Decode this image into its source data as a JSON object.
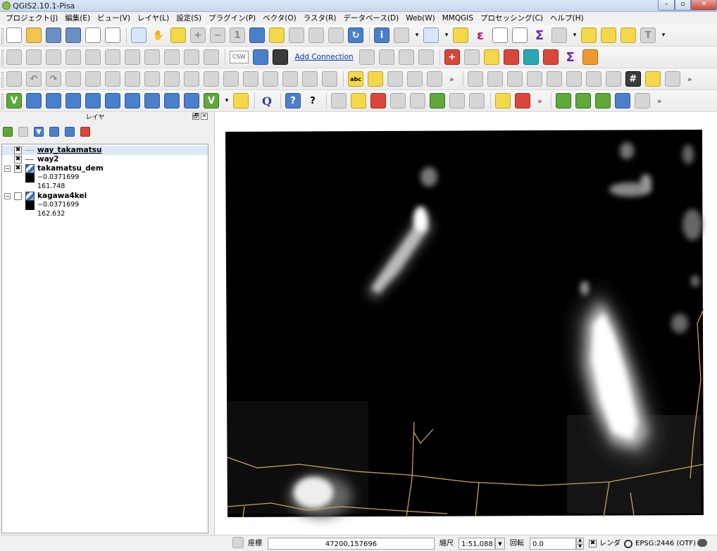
{
  "window": {
    "title": "QGIS2.10.1-Pisa",
    "min_glyph": "–",
    "max_glyph": "▫",
    "close_glyph": "✕"
  },
  "menu": [
    "プロジェクト(J)",
    "編集(E)",
    "ビュー(V)",
    "レイヤ(L)",
    "設定(S)",
    "プラグイン(P)",
    "ベクタ(O)",
    "ラスタ(R)",
    "データベース(D)",
    "Web(W)",
    "MMQGIS",
    "プロセッシング(C)",
    "ヘルプ(H)"
  ],
  "toolbar": {
    "csw_label": "CSW",
    "add_connection": "Add Connection",
    "abc": "abc",
    "more": "»",
    "help_glyph": "?",
    "whatsthis_glyph": "?",
    "sigma_glyph": "Σ",
    "epsilon_glyph": "ε",
    "q_logo": "Q"
  },
  "layers_panel": {
    "title": "レイヤ",
    "float_glyph": "🗗",
    "close_glyph": "✕",
    "expand_glyph": "−",
    "check_glyph": "✖",
    "layers": [
      {
        "name": "way_takamatsu",
        "checked": true,
        "kind": "line",
        "color": "#a8a8a8",
        "selected": true
      },
      {
        "name": "way2",
        "checked": true,
        "kind": "line",
        "color": "#c8485a"
      },
      {
        "name": "takamatsu_dem",
        "checked": true,
        "kind": "raster",
        "min": "−0.0371699",
        "max": "161.748"
      },
      {
        "name": "kagawa4kei",
        "checked": false,
        "kind": "raster",
        "min": "−0.0371699",
        "max": "162.632"
      }
    ]
  },
  "status": {
    "coord_label": "座標",
    "coord_value": "47200,157696",
    "scale_label": "縮尺",
    "scale_value": "1:51,088",
    "rotation_label": "回転",
    "rotation_value": "0.0",
    "render_label": "レンダ",
    "render_checked": "✖",
    "crs_label": "EPSG:2446 (OTF)",
    "dropdown_glyph": "▼",
    "spin_up": "▲",
    "spin_down": "▼"
  },
  "colors": {
    "road": "#c8a25a",
    "titlebar": "#c5d7ef"
  }
}
